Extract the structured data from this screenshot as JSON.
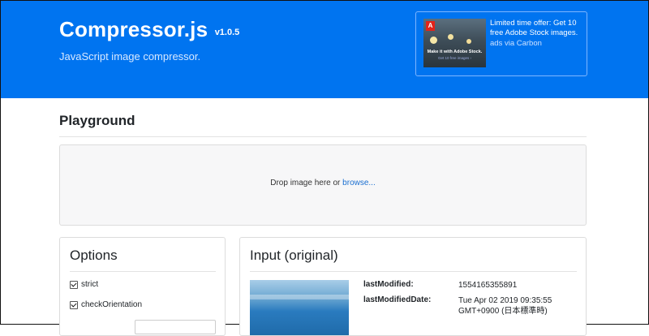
{
  "header": {
    "title": "Compressor.js",
    "version": "v1.0.5",
    "subtitle": "JavaScript image compressor.",
    "accent_color": "#0074f0"
  },
  "ad": {
    "logo_text": "A",
    "image_cta": "Make it with Adobe Stock.",
    "image_sub": "Get 10 free images ›",
    "text": "Limited time offer: Get 10 free Adobe Stock images.",
    "via": "ads via Carbon"
  },
  "playground": {
    "title": "Playground",
    "drop_text": "Drop image here or ",
    "browse_label": "browse..."
  },
  "options": {
    "title": "Options",
    "items": [
      {
        "label": "strict",
        "checked": true
      },
      {
        "label": "checkOrientation",
        "checked": true
      }
    ]
  },
  "input": {
    "title": "Input (original)",
    "fields": [
      {
        "label": "lastModified:",
        "value": "1554165355891"
      },
      {
        "label": "lastModifiedDate:",
        "value": "Tue Apr 02 2019 09:35:55 GMT+0900 (日本標準時)"
      }
    ]
  }
}
